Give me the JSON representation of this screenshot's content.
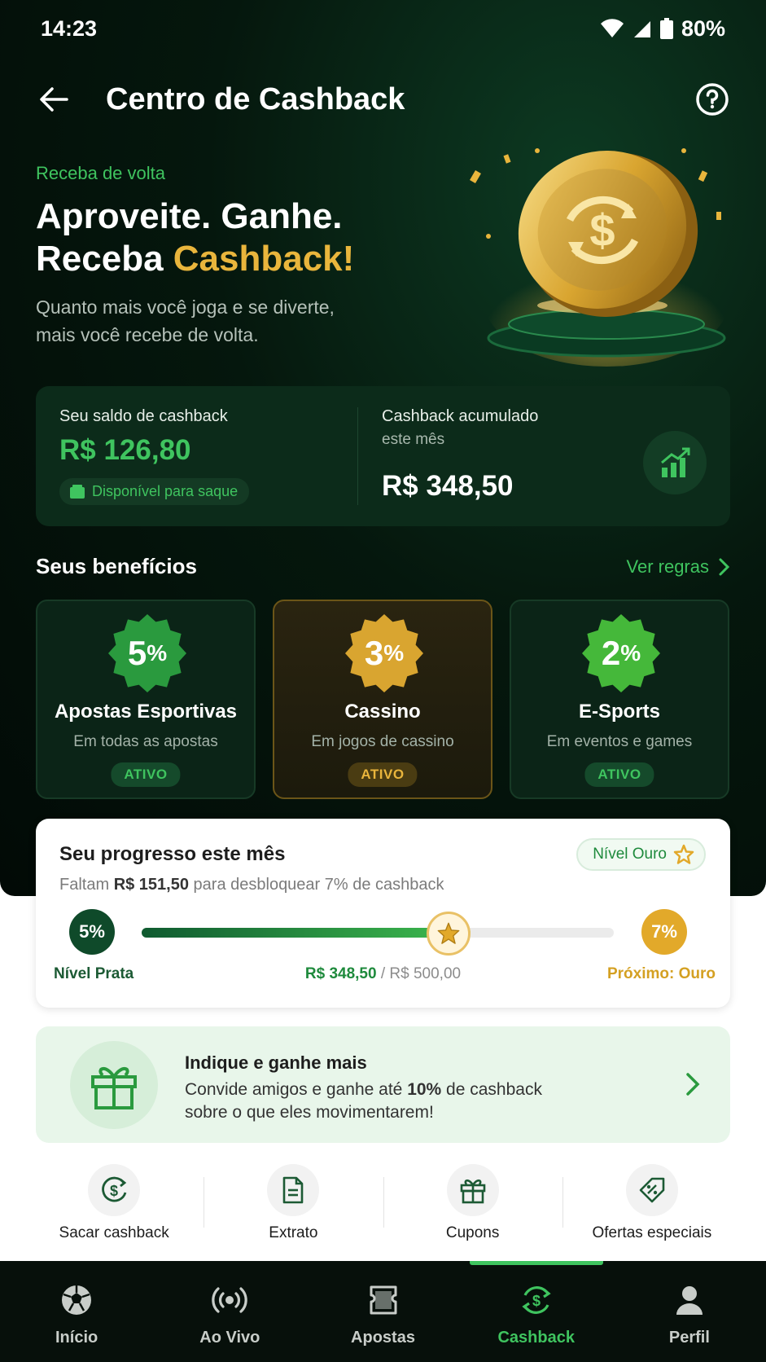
{
  "status_bar": {
    "time": "14:23",
    "battery": "80%"
  },
  "header": {
    "title": "Centro de Cashback"
  },
  "hero": {
    "eyebrow": "Receba de volta",
    "headline_line1": "Aproveite. Ganhe.",
    "headline_line2_prefix": "Receba ",
    "headline_line2_accent": "Cashback!",
    "subtitle": "Quanto mais você joga e se diverte, mais você recebe de volta."
  },
  "balance": {
    "label": "Seu saldo de cashback",
    "value": "R$ 126,80",
    "badge": "Disponível para saque",
    "accumulated_label": "Cashback acumulado",
    "accumulated_sub": "este mês",
    "accumulated_value": "R$ 348,50"
  },
  "benefits": {
    "title": "Seus benefícios",
    "link": "Ver regras",
    "items": [
      {
        "pct": "5",
        "unit": "%",
        "name": "Apostas Esportivas",
        "desc": "Em todas as apostas",
        "status": "ATIVO",
        "color": "#2a9a3e"
      },
      {
        "pct": "3",
        "unit": "%",
        "name": "Cassino",
        "desc": "Em jogos de cassino",
        "status": "ATIVO",
        "color": "#d9a530"
      },
      {
        "pct": "2",
        "unit": "%",
        "name": "E-Sports",
        "desc": "Em eventos e games",
        "status": "ATIVO",
        "color": "#45b83a"
      }
    ]
  },
  "progress": {
    "title": "Seu progresso este mês",
    "badge": "Nível Ouro",
    "sub_prefix": "Faltam ",
    "sub_amount": "R$ 151,50",
    "sub_suffix": " para desbloquear 7% de cashback",
    "current_pct": "5%",
    "next_pct": "7%",
    "current_level": "Nível Prata",
    "next_level": "Próximo: Ouro",
    "current_amount": "R$ 348,50",
    "target_amount": " / R$ 500,00",
    "fill_fraction": 0.697
  },
  "refer": {
    "title": "Indique e ganhe mais",
    "desc_prefix": "Convide amigos e ganhe até ",
    "desc_bold": "10%",
    "desc_suffix": " de cashback sobre o que eles movimentarem!"
  },
  "quick_actions": [
    {
      "label": "Sacar cashback",
      "icon": "dollar-circle-icon"
    },
    {
      "label": "Extrato",
      "icon": "document-icon"
    },
    {
      "label": "Cupons",
      "icon": "gift-icon"
    },
    {
      "label": "Ofertas especiais",
      "icon": "percent-tag-icon"
    }
  ],
  "bottom_nav": [
    {
      "label": "Início",
      "icon": "soccer-ball-icon"
    },
    {
      "label": "Ao Vivo",
      "icon": "broadcast-icon"
    },
    {
      "label": "Apostas",
      "icon": "ticket-icon"
    },
    {
      "label": "Cashback",
      "icon": "cashback-icon",
      "active": true
    },
    {
      "label": "Perfil",
      "icon": "profile-icon"
    }
  ],
  "colors": {
    "accent_green": "#3fc45f",
    "accent_gold": "#e9b53c",
    "dark_bg": "#05170d"
  }
}
